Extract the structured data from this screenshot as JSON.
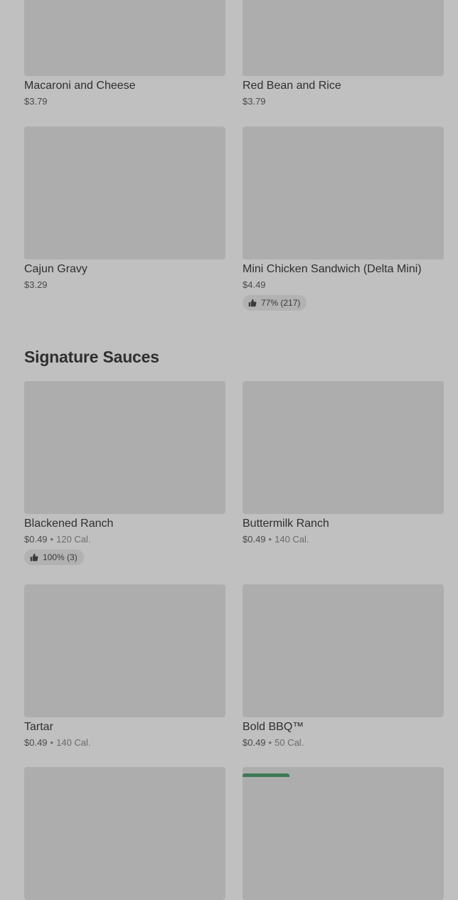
{
  "menu_rows": [
    {
      "items": [
        {
          "name": "Macaroni and Cheese",
          "price": "$3.79"
        },
        {
          "name": "Red Bean and Rice",
          "price": "$3.79"
        }
      ]
    },
    {
      "items": [
        {
          "name": "Cajun Gravy",
          "price": "$3.29"
        },
        {
          "name": "Mini Chicken Sandwich (Delta Mini)",
          "price": "$4.49",
          "rating": "77% (217)"
        }
      ]
    }
  ],
  "signature_sauces": {
    "title": "Signature Sauces",
    "items": [
      {
        "name": "Blackened Ranch",
        "price": "$0.49",
        "calories": "120 Cal.",
        "rating": "100% (3)"
      },
      {
        "name": "Buttermilk Ranch",
        "price": "$0.49",
        "calories": "140 Cal."
      },
      {
        "name": "Tartar",
        "price": "$0.49",
        "calories": "140 Cal."
      },
      {
        "name": "Bold BBQ™",
        "price": "$0.49",
        "calories": "50 Cal."
      }
    ]
  },
  "icons": {
    "rating": "thumbs-up-icon"
  },
  "colors": {
    "background": "#c0c0c0",
    "image_placeholder": "#adadad",
    "badge_green": "#3d7a54"
  }
}
